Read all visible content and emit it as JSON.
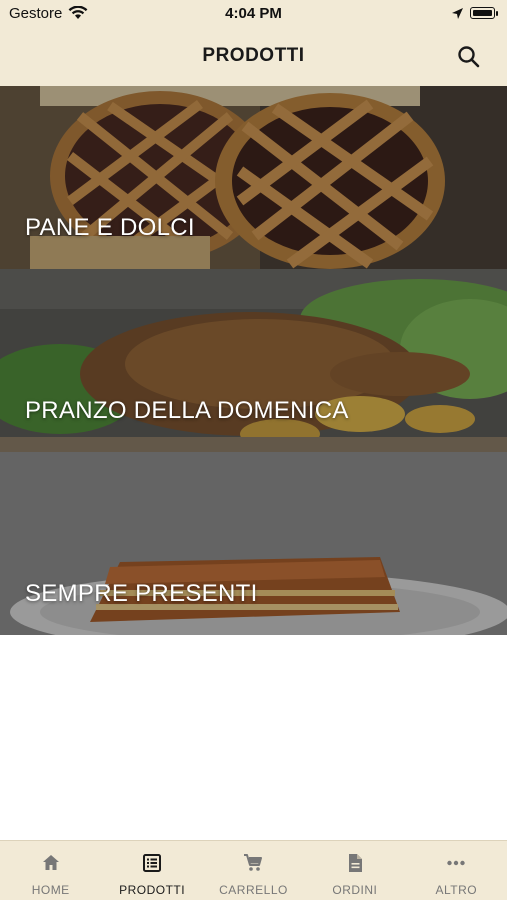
{
  "status_bar": {
    "carrier": "Gestore",
    "time": "4:04 PM"
  },
  "header": {
    "title": "PRODOTTI"
  },
  "categories": [
    {
      "label": "PANE E DOLCI",
      "image": "crostata-icon"
    },
    {
      "label": "PRANZO DELLA DOMENICA",
      "image": "roast-duck-icon"
    },
    {
      "label": "SEMPRE PRESENTI",
      "image": "lasagna-icon"
    }
  ],
  "tab_bar": {
    "active": "PRODOTTI",
    "tabs": [
      {
        "label": "HOME",
        "icon": "home-icon"
      },
      {
        "label": "PRODOTTI",
        "icon": "list-icon"
      },
      {
        "label": "CARRELLO",
        "icon": "cart-icon"
      },
      {
        "label": "ORDINI",
        "icon": "document-icon"
      },
      {
        "label": "ALTRO",
        "icon": "more-icon"
      }
    ]
  }
}
